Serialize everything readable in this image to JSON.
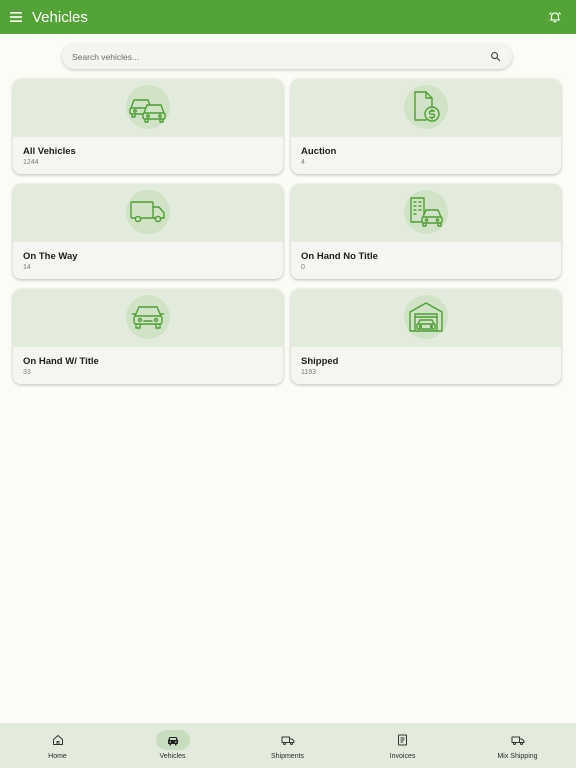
{
  "header": {
    "title": "Vehicles",
    "menu_icon": "hamburger-menu-icon",
    "bell_icon": "notification-bell-icon",
    "background_color": "#53a336"
  },
  "search": {
    "placeholder": "Search vehicles...",
    "icon": "search-icon"
  },
  "cards": [
    {
      "label": "All Vehicles",
      "count": "1244",
      "icon": "cars-icon"
    },
    {
      "label": "Auction",
      "count": "4",
      "icon": "document-dollar-icon"
    },
    {
      "label": "On The Way",
      "count": "14",
      "icon": "truck-icon"
    },
    {
      "label": "On Hand No Title",
      "count": "0",
      "icon": "building-car-icon"
    },
    {
      "label": "On Hand W/ Title",
      "count": "33",
      "icon": "car-icon"
    },
    {
      "label": "Shipped",
      "count": "1193",
      "icon": "garage-car-icon"
    }
  ],
  "bottom_nav": {
    "items": [
      {
        "label": "Home",
        "icon": "home-icon",
        "active": false
      },
      {
        "label": "Vehicles",
        "icon": "car-icon",
        "active": true
      },
      {
        "label": "Shipments",
        "icon": "truck-icon",
        "active": false
      },
      {
        "label": "Invoices",
        "icon": "invoice-icon",
        "active": false
      },
      {
        "label": "Mix Shipping",
        "icon": "truck-icon",
        "active": false
      }
    ]
  },
  "colors": {
    "accent": "#53a336",
    "icon_green": "#4f9d34",
    "card_banner": "#e3ecdc",
    "nav_background": "#e3ebdc"
  }
}
